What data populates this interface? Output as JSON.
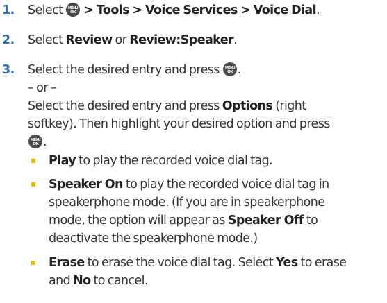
{
  "steps": [
    {
      "number": "1.",
      "prefix": "Select",
      "menu_key_icon": "menu-ok-key-icon",
      "path": "> Tools > Voice Services > Voice Dial",
      "suffix": "."
    },
    {
      "number": "2.",
      "prefix": "Select",
      "option_a": "Review",
      "connector": "or",
      "option_b": "Review:Speaker",
      "suffix": "."
    },
    {
      "number": "3.",
      "line1": "Select the desired entry and press",
      "line1_suffix": ".",
      "or_text": "– or –",
      "line3_prefix": "Select the desired entry and press",
      "options_label": "Options",
      "line3_suffix": "(right",
      "line4": "softkey). Then highlight your desired option and press",
      "line5_suffix": "."
    }
  ],
  "bullets": [
    {
      "term": "Play",
      "lines": [
        "to play the recorded voice dial tag."
      ]
    },
    {
      "term": "Speaker On",
      "line1": "to play the recorded voice dial tag in",
      "line2": "speakerphone mode. (If you are in speakerphone",
      "line3_prefix": "mode, the option will appear as",
      "line3_term": "Speaker Off",
      "line3_suffix": "to",
      "line4": "deactivate the speakerphone mode.)"
    },
    {
      "term": "Erase",
      "line1_mid": "to erase the voice dial tag. Select",
      "yes_term": "Yes",
      "line1_suffix": "to erase",
      "line2_prefix": "and",
      "no_term": "No",
      "line2_suffix": "to cancel."
    }
  ],
  "key_glyph": {
    "top": "MENU",
    "bottom": "OK"
  },
  "colors": {
    "step_number": "#2a6fb4",
    "bullet_square": "#f5b400",
    "key_background": "#4a4a4a"
  }
}
